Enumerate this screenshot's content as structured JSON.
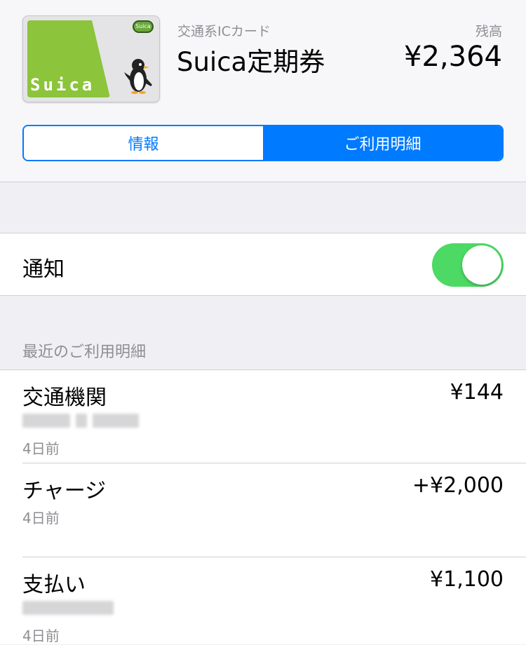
{
  "card": {
    "type": "交通系ICカード",
    "name": "Suica定期券",
    "logo_text": "Suica",
    "badge_text": "Suica",
    "balance_label": "残高",
    "balance": "¥2,364",
    "brand_color": "#8cc43c"
  },
  "tabs": [
    {
      "label": "情報",
      "active": false
    },
    {
      "label": "ご利用明細",
      "active": true
    }
  ],
  "notifications": {
    "label": "通知",
    "enabled": true
  },
  "history": {
    "section_title": "最近のご利用明細",
    "items": [
      {
        "title": "交通機関",
        "amount": "¥144",
        "time": "4日前"
      },
      {
        "title": "チャージ",
        "amount": "+¥2,000",
        "time": "4日前"
      },
      {
        "title": "支払い",
        "amount": "¥1,100",
        "time": "4日前"
      }
    ]
  },
  "colors": {
    "accent": "#007aff",
    "toggle_on": "#4cd964"
  }
}
